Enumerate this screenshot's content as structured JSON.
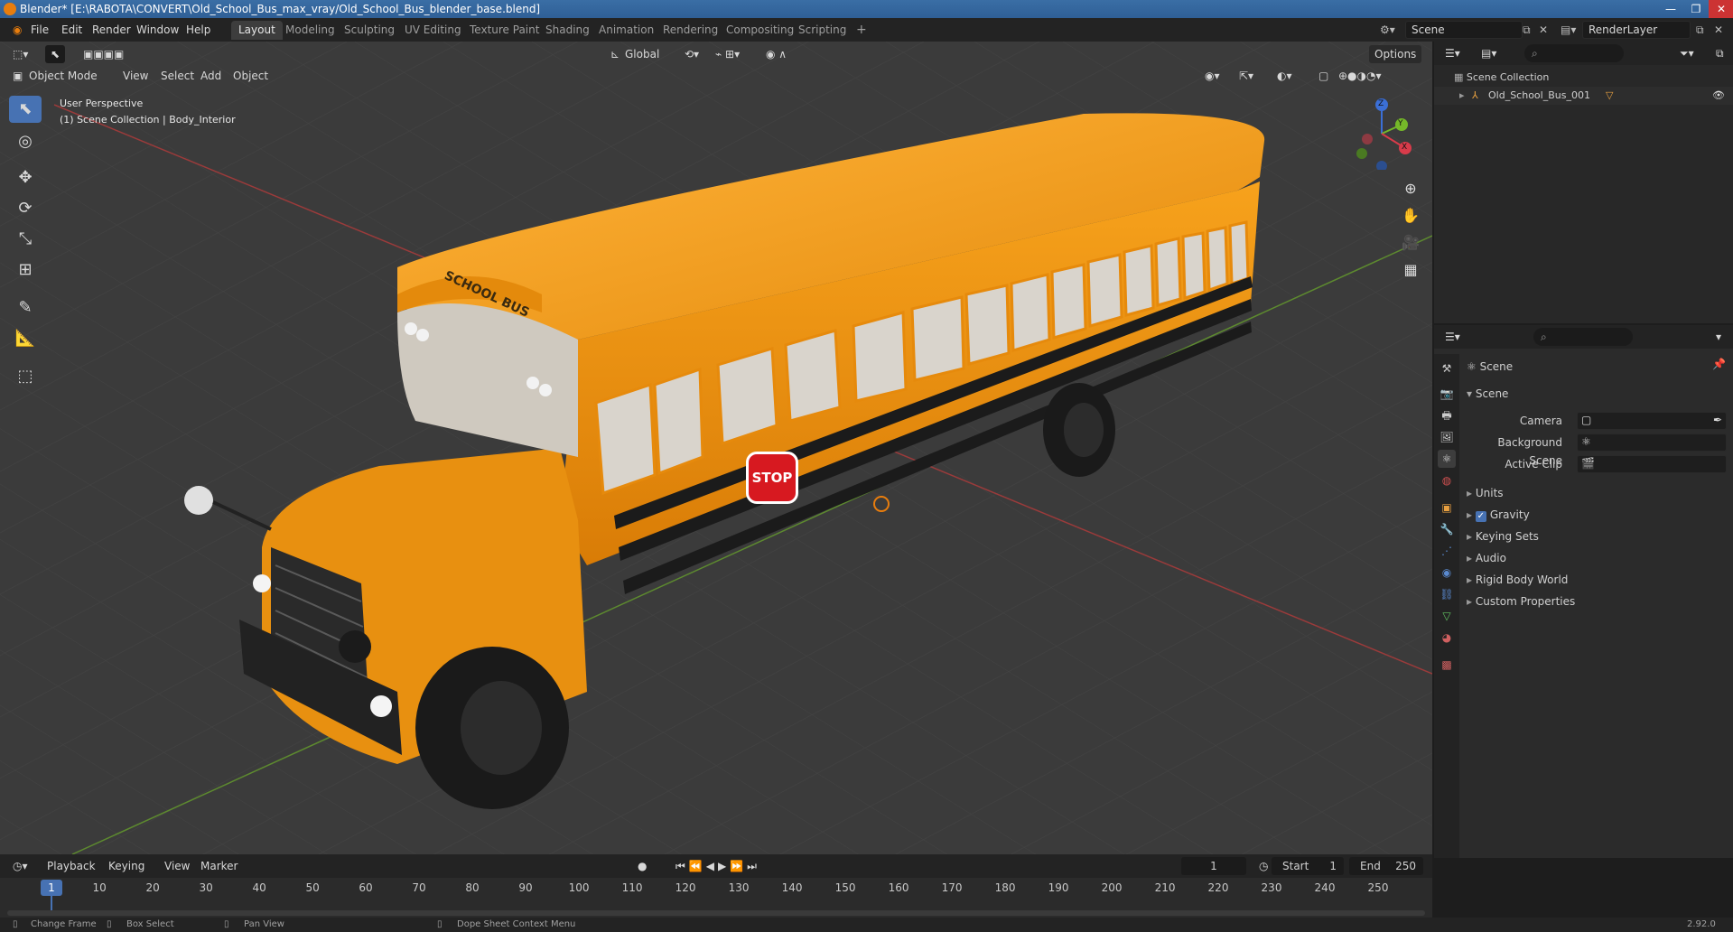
{
  "title_bar": {
    "text": "Blender* [E:\\RABOTA\\CONVERT\\Old_School_Bus_max_vray/Old_School_Bus_blender_base.blend]",
    "controls": [
      "—",
      "❐",
      "✕"
    ]
  },
  "menu": {
    "items": [
      "File",
      "Edit",
      "Render",
      "Window",
      "Help"
    ],
    "workspaces": [
      "Layout",
      "Modeling",
      "Sculpting",
      "UV Editing",
      "Texture Paint",
      "Shading",
      "Animation",
      "Rendering",
      "Compositing",
      "Scripting"
    ],
    "active_workspace": "Layout",
    "add_tab_symbol": "+",
    "scene_name": "Scene",
    "render_layer": "RenderLayer"
  },
  "viewport": {
    "mode": "Object Mode",
    "menus": [
      "View",
      "Select",
      "Add",
      "Object"
    ],
    "transform_orientation": "Global",
    "options_label": "Options",
    "overlay_text_line1": "User Perspective",
    "overlay_text_line2": "(1) Scene Collection | Body_Interior",
    "gizmo_axes": [
      "Z",
      "Y",
      "X"
    ],
    "bus_sign_text": "SCHOOL BUS",
    "stop_sign_text": "STOP"
  },
  "outliner": {
    "root": "Scene Collection",
    "items": [
      {
        "name": "Old_School_Bus_001"
      }
    ]
  },
  "properties": {
    "header_title": "Scene",
    "section": "Scene",
    "fields": [
      {
        "label": "Camera",
        "value": ""
      },
      {
        "label": "Background Scene",
        "value": ""
      },
      {
        "label": "Active Clip",
        "value": ""
      }
    ],
    "panels": [
      "Units",
      "Gravity",
      "Keying Sets",
      "Audio",
      "Rigid Body World",
      "Custom Properties"
    ],
    "gravity_checked": true
  },
  "timeline": {
    "menus": [
      "Playback",
      "Keying",
      "View",
      "Marker"
    ],
    "current_frame": "1",
    "start_label": "Start",
    "start": "1",
    "end_label": "End",
    "end": "250",
    "ticks": [
      "1",
      "10",
      "20",
      "30",
      "40",
      "50",
      "60",
      "70",
      "80",
      "90",
      "100",
      "110",
      "120",
      "130",
      "140",
      "150",
      "160",
      "170",
      "180",
      "190",
      "200",
      "210",
      "220",
      "230",
      "240",
      "250"
    ]
  },
  "status_bar": {
    "items": [
      "Change Frame",
      "Box Select",
      "Pan View",
      "Dope Sheet Context Menu"
    ],
    "version": "2.92.0"
  }
}
